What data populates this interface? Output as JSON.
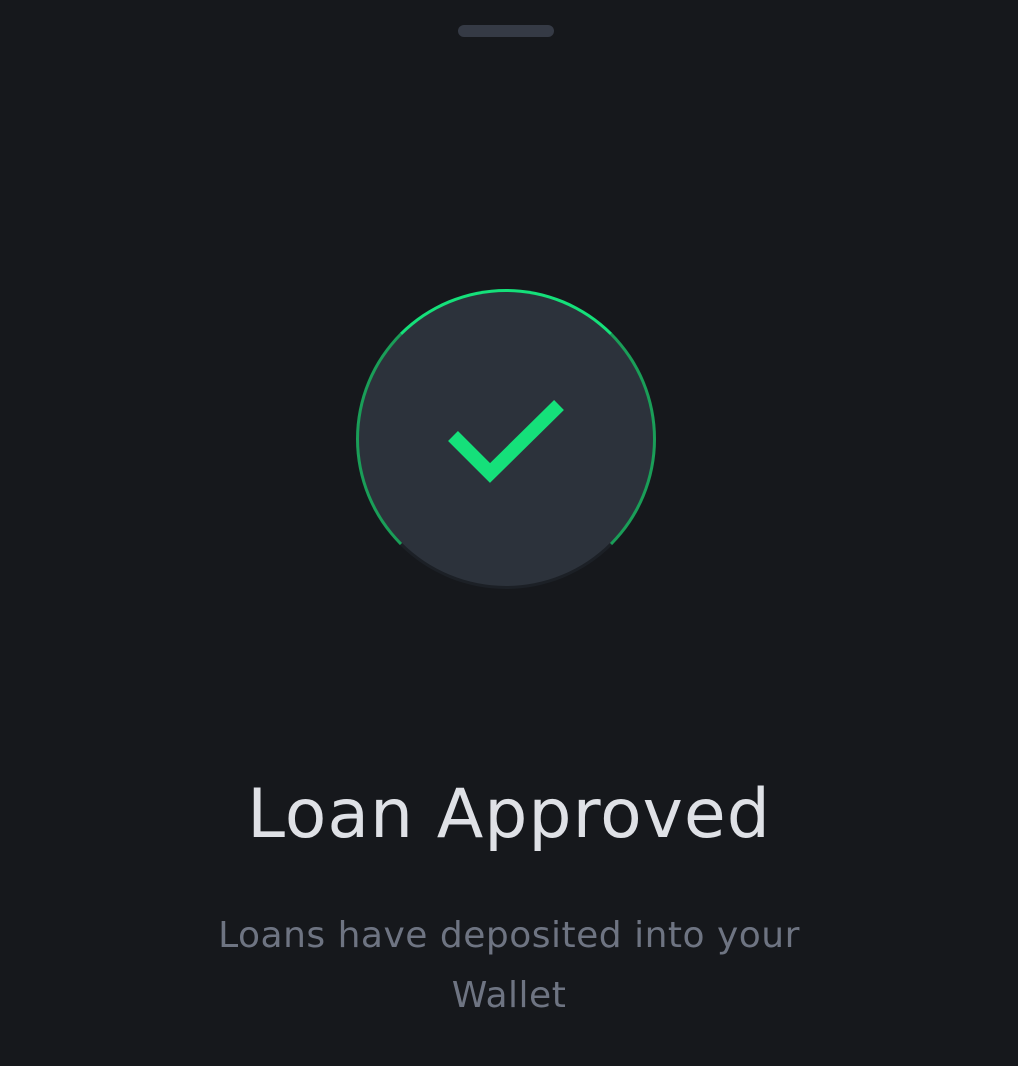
{
  "success": {
    "icon": "check-icon",
    "title": "Loan Approved",
    "message": "Loans have deposited into your Wallet"
  },
  "colors": {
    "background": "#16181c",
    "accent": "#15e07a",
    "circle_fill": "#2c323b",
    "title_text": "#dfe1e6",
    "subtitle_text": "#6e7482",
    "handle": "#353a45"
  }
}
